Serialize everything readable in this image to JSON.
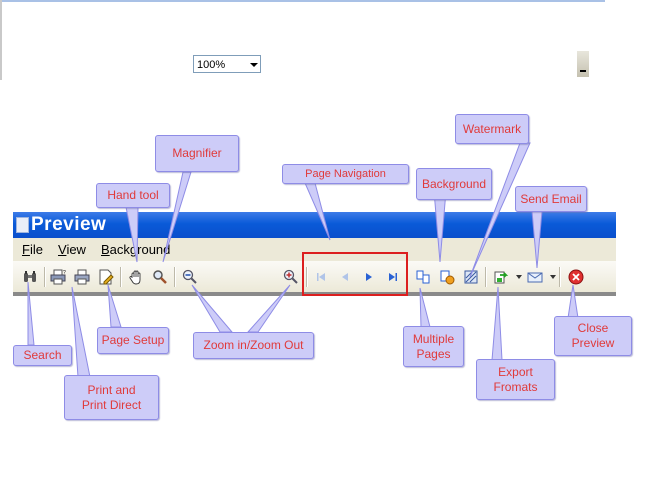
{
  "window": {
    "title": "Preview"
  },
  "menu": {
    "items": [
      "File",
      "View",
      "Background"
    ]
  },
  "toolbar": {
    "zoom_value": "100%",
    "icons": [
      "binoculars-icon",
      "print-icon",
      "print-direct-icon",
      "page-setup-icon",
      "hand-icon",
      "magnifier-icon",
      "zoom-out-icon",
      "zoom-in-icon",
      "first-page-icon",
      "prev-page-icon",
      "next-page-icon",
      "last-page-icon",
      "multiple-pages-icon",
      "background-icon",
      "watermark-icon",
      "export-icon",
      "email-icon",
      "close-icon"
    ]
  },
  "callouts": {
    "magnifier": "Magnifier",
    "hand_tool": "Hand tool",
    "page_navigation": "Page Navigation",
    "background": "Background",
    "watermark": "Watermark",
    "send_email": "Send Email",
    "search": "Search",
    "page_setup": "Page Setup",
    "zoom": "Zoom in/Zoom Out",
    "print_line1": "Print and",
    "print_line2": "Print Direct",
    "multiple_line1": "Multiple",
    "multiple_line2": "Pages",
    "export_line1": "Export",
    "export_line2": "Fromats",
    "close_line1": "Close",
    "close_line2": "Preview"
  },
  "colors": {
    "callout_fill": "#cdccf8",
    "callout_text": "#e03a3a",
    "highlight": "#dc1f1f",
    "titlebar": "#0a5ad8"
  }
}
